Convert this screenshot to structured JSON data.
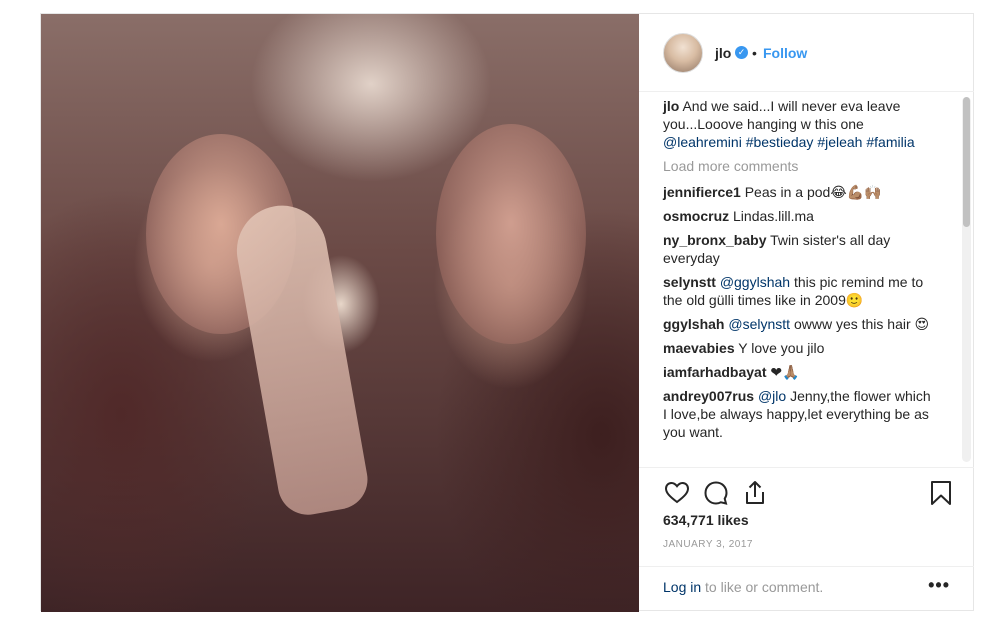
{
  "header": {
    "username": "jlo",
    "separator": "•",
    "follow_label": "Follow",
    "verified_icon": "verified-badge-icon"
  },
  "caption": {
    "username": "jlo",
    "text": "And we said...I will never eva leave you...Looove hanging w this one",
    "tags": [
      "@leahremini",
      "#bestieday",
      "#jeleah",
      "#familia"
    ]
  },
  "load_more_label": "Load more comments",
  "comments": [
    {
      "user": "jennifierce1",
      "text": "Peas in a pod😂💪🏽🙌🏽"
    },
    {
      "user": "osmocruz",
      "text": "Lindas.lill.ma"
    },
    {
      "user": "ny_bronx_baby",
      "text": "Twin sister's all day everyday"
    },
    {
      "user": "selynstt",
      "mention": "@ggylshah",
      "text": "this pic remind me to the old gülli times like in 2009🙂"
    },
    {
      "user": "ggylshah",
      "mention": "@selynstt",
      "text": "owww yes this hair 😍"
    },
    {
      "user": "maevabies",
      "text": "Y love you jilo"
    },
    {
      "user": "iamfarhadbayat",
      "text": "❤🙏🏽"
    },
    {
      "user": "andrey007rus",
      "mention": "@jlo",
      "text": "Jenny,the flower which I love,be always happy,let everything be as you want."
    }
  ],
  "likes": "634,771 likes",
  "date": "JANUARY 3, 2017",
  "footer": {
    "login_link": "Log in",
    "login_rest": "to like or comment.",
    "more_options": "•••"
  },
  "colors": {
    "link": "#003569",
    "accent": "#3897f0",
    "muted": "#999999"
  }
}
